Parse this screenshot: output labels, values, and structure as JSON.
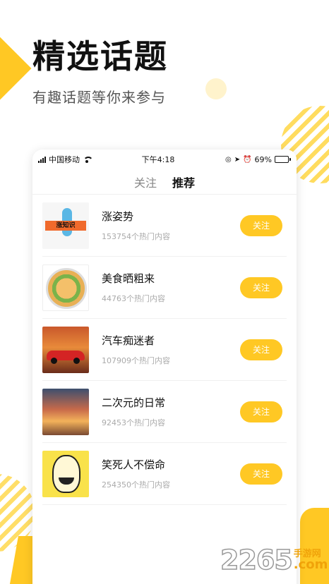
{
  "promo": {
    "headline": "精选话题",
    "subhead": "有趣话题等你来参与"
  },
  "statusbar": {
    "carrier": "中国移动",
    "time": "下午4:18",
    "battery": "69%",
    "battery_level": 0.69
  },
  "tabs": [
    {
      "label": "关注",
      "active": false
    },
    {
      "label": "推荐",
      "active": true
    }
  ],
  "topics": [
    {
      "name": "涨姿势",
      "count": "153754个热门内容",
      "button": "关注",
      "thumb_text": "涨知识"
    },
    {
      "name": "美食晒粗来",
      "count": "44763个热门内容",
      "button": "关注"
    },
    {
      "name": "汽车痴迷者",
      "count": "107909个热门内容",
      "button": "关注"
    },
    {
      "name": "二次元的日常",
      "count": "92453个热门内容",
      "button": "关注"
    },
    {
      "name": "笑死人不偿命",
      "count": "254350个热门内容",
      "button": "关注"
    }
  ],
  "watermark": {
    "number": "2265",
    "cn": "手游网",
    "com": ".com"
  },
  "colors": {
    "accent": "#ffc824",
    "text_primary": "#111111",
    "text_secondary": "#aaaaaa"
  }
}
